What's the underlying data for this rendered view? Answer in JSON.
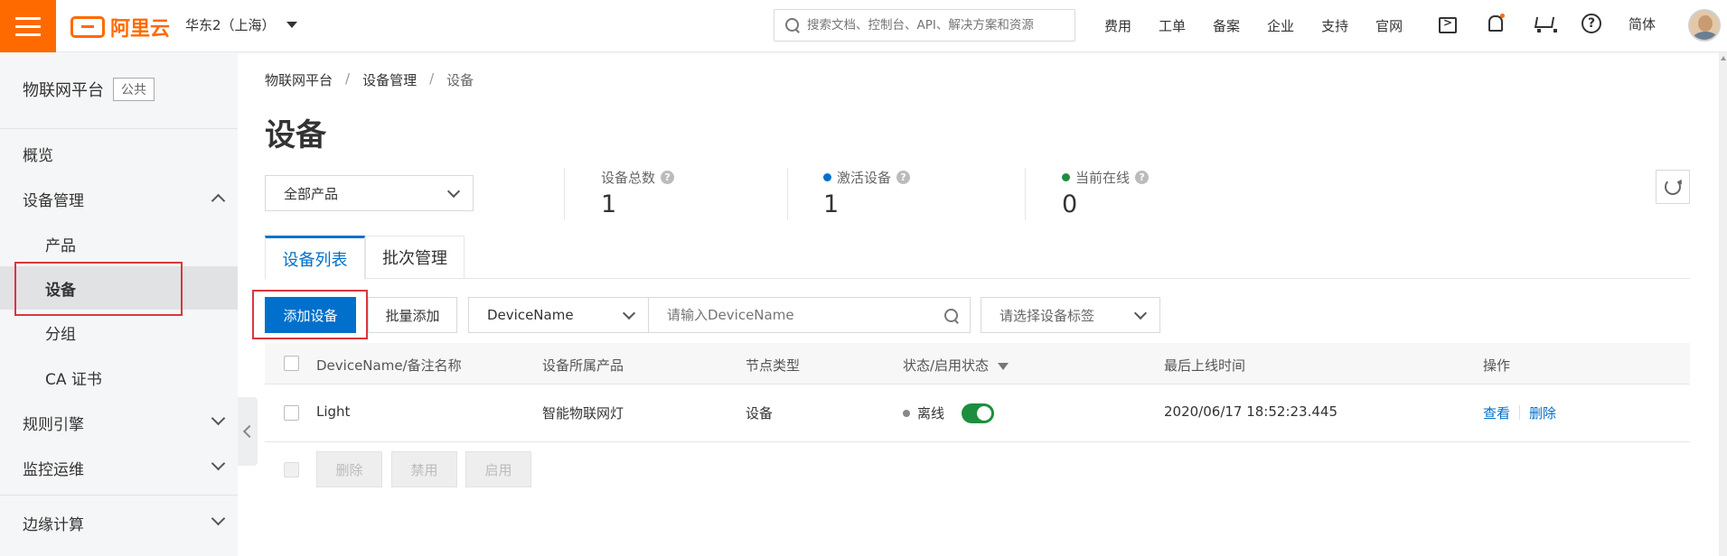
{
  "topbar": {
    "logo_text": "阿里云",
    "region": "华东2（上海）",
    "search_placeholder": "搜索文档、控制台、API、解决方案和资源",
    "nav_links": [
      "费用",
      "工单",
      "备案",
      "企业",
      "支持",
      "官网"
    ],
    "language": "简体",
    "help_glyph": "?",
    "icons": [
      "terminal-icon",
      "bell-icon",
      "cart-icon",
      "help-icon"
    ],
    "accent_color": "#ff6a00"
  },
  "sidebar": {
    "title": "物联网平台",
    "tag": "公共",
    "items": [
      {
        "label": "概览",
        "level": 1
      },
      {
        "label": "设备管理",
        "level": 1,
        "expanded": true
      },
      {
        "label": "产品",
        "level": 2
      },
      {
        "label": "设备",
        "level": 2,
        "active": true
      },
      {
        "label": "分组",
        "level": 2
      },
      {
        "label": "CA 证书",
        "level": 2
      },
      {
        "label": "规则引擎",
        "level": 1,
        "expanded": false
      },
      {
        "label": "监控运维",
        "level": 1,
        "expanded": false
      },
      {
        "label": "边缘计算",
        "level": 1,
        "expanded": false
      }
    ]
  },
  "breadcrumb": {
    "items": [
      "物联网平台",
      "设备管理",
      "设备"
    ],
    "separator": "/"
  },
  "page_title": "设备",
  "product_select": {
    "value": "全部产品"
  },
  "stats": {
    "total": {
      "label": "设备总数",
      "value": "1"
    },
    "activated": {
      "label": "激活设备",
      "value": "1",
      "dot_color": "#0070cc"
    },
    "online": {
      "label": "当前在线",
      "value": "0",
      "dot_color": "#1e8e3e"
    },
    "help_glyph": "?"
  },
  "tabs": [
    {
      "label": "设备列表",
      "active": true
    },
    {
      "label": "批次管理",
      "active": false
    }
  ],
  "toolbar": {
    "add_device": "添加设备",
    "batch_add": "批量添加",
    "field_select": "DeviceName",
    "search_placeholder": "请输入DeviceName",
    "tag_select_placeholder": "请选择设备标签"
  },
  "table": {
    "columns": [
      "DeviceName/备注名称",
      "设备所属产品",
      "节点类型",
      "状态/启用状态",
      "最后上线时间",
      "操作"
    ],
    "rows": [
      {
        "name": "Light",
        "product": "智能物联网灯",
        "node_type": "设备",
        "status": "离线",
        "enabled": true,
        "last_online": "2020/06/17 18:52:23.445",
        "actions": [
          "查看",
          "删除"
        ]
      }
    ],
    "bulk_actions": [
      "删除",
      "禁用",
      "启用"
    ]
  },
  "colors": {
    "primary": "#0070cc",
    "highlight_box": "#d9363e",
    "toggle_on": "#1e8e3e",
    "offline_dot": "#888888"
  }
}
